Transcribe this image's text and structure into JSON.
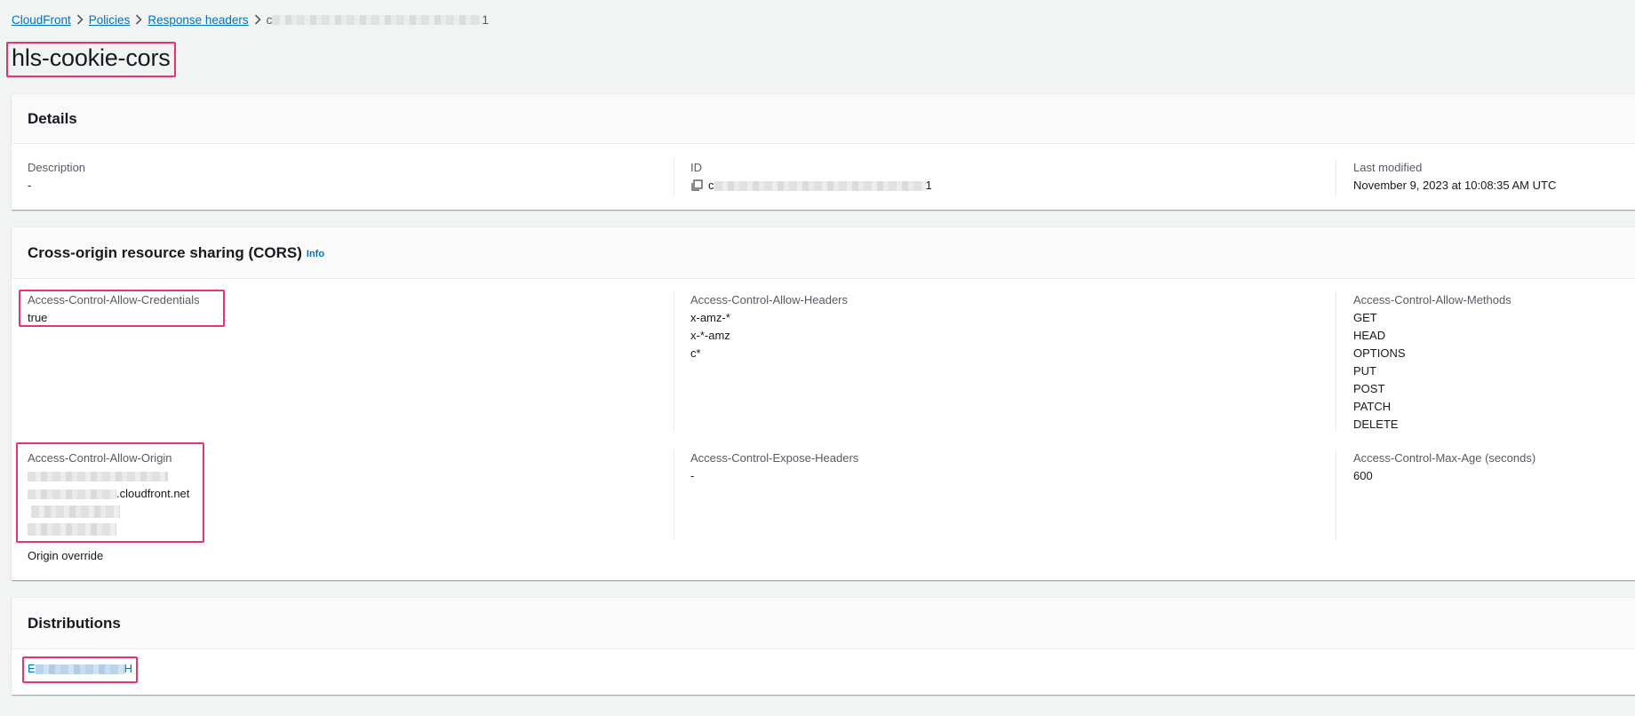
{
  "breadcrumb": {
    "items": [
      "CloudFront",
      "Policies",
      "Response headers"
    ],
    "current_prefix": "c",
    "current_suffix": "1"
  },
  "page": {
    "title": "hls-cookie-cors"
  },
  "details": {
    "header": "Details",
    "description_label": "Description",
    "description_value": "-",
    "id_label": "ID",
    "id_prefix": "c",
    "id_suffix": "1",
    "modified_label": "Last modified",
    "modified_value": "November 9, 2023 at 10:08:35 AM UTC"
  },
  "cors": {
    "header": "Cross-origin resource sharing (CORS)",
    "info": "Info",
    "credentials_label": "Access-Control-Allow-Credentials",
    "credentials_value": "true",
    "headers_label": "Access-Control-Allow-Headers",
    "headers_values": [
      "x-amz-*",
      "x-*-amz",
      "c*"
    ],
    "methods_label": "Access-Control-Allow-Methods",
    "methods_values": [
      "GET",
      "HEAD",
      "OPTIONS",
      "PUT",
      "POST",
      "PATCH",
      "DELETE"
    ],
    "origin_label": "Access-Control-Allow-Origin",
    "origin_domain_suffix": ".cloudfront.net",
    "origin_override": "Origin override",
    "expose_label": "Access-Control-Expose-Headers",
    "expose_value": "-",
    "maxage_label": "Access-Control-Max-Age (seconds)",
    "maxage_value": "600"
  },
  "distributions": {
    "header": "Distributions",
    "item_prefix": "E",
    "item_suffix": "H"
  },
  "colors": {
    "link": "#0073bb",
    "highlight": "#e8336e",
    "background": "#f2f3f3"
  }
}
